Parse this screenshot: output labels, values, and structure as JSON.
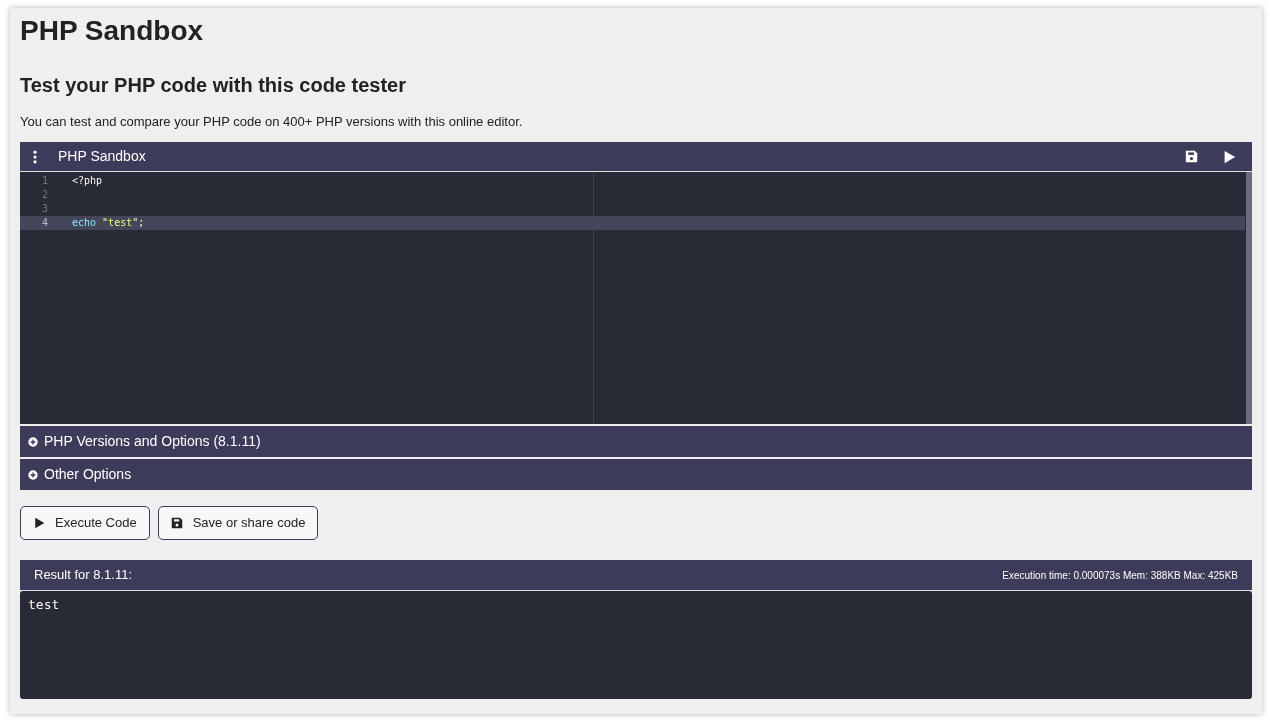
{
  "page": {
    "title": "PHP Sandbox",
    "subtitle": "Test your PHP code with this code tester",
    "intro": "You can test and compare your PHP code on 400+ PHP versions with this online editor."
  },
  "editor": {
    "title": "PHP Sandbox",
    "lines": [
      {
        "number": "1",
        "active": false,
        "tokens": [
          {
            "kind": "tag",
            "text": "<?php"
          }
        ]
      },
      {
        "number": "2",
        "active": false
      },
      {
        "number": "3",
        "active": false
      },
      {
        "number": "4",
        "active": true,
        "tokens": [
          {
            "kind": "keyword",
            "text": "echo"
          },
          {
            "kind": "string",
            "text": "\"test\""
          },
          {
            "kind": "punct",
            "text": ";"
          }
        ]
      }
    ]
  },
  "sections": [
    {
      "label": "PHP Versions and Options (8.1.11)",
      "expanded": false
    },
    {
      "label": "Other Options",
      "expanded": false
    }
  ],
  "buttons": [
    {
      "kind": "run",
      "label": "Execute Code"
    },
    {
      "kind": "save",
      "label": "Save or share code"
    }
  ],
  "result": {
    "title": "Result for 8.1.11:",
    "stats": "Execution time: 0.000073s Mem: 388KB Max: 425KB",
    "output": "test"
  }
}
